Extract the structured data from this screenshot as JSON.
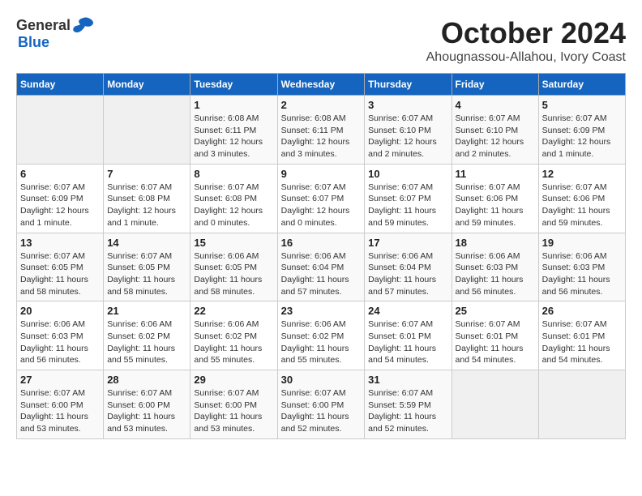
{
  "logo": {
    "general": "General",
    "blue": "Blue"
  },
  "title": "October 2024",
  "subtitle": "Ahougnassou-Allahou, Ivory Coast",
  "weekdays": [
    "Sunday",
    "Monday",
    "Tuesday",
    "Wednesday",
    "Thursday",
    "Friday",
    "Saturday"
  ],
  "weeks": [
    [
      {
        "day": "",
        "info": ""
      },
      {
        "day": "",
        "info": ""
      },
      {
        "day": "1",
        "info": "Sunrise: 6:08 AM\nSunset: 6:11 PM\nDaylight: 12 hours and 3 minutes."
      },
      {
        "day": "2",
        "info": "Sunrise: 6:08 AM\nSunset: 6:11 PM\nDaylight: 12 hours and 3 minutes."
      },
      {
        "day": "3",
        "info": "Sunrise: 6:07 AM\nSunset: 6:10 PM\nDaylight: 12 hours and 2 minutes."
      },
      {
        "day": "4",
        "info": "Sunrise: 6:07 AM\nSunset: 6:10 PM\nDaylight: 12 hours and 2 minutes."
      },
      {
        "day": "5",
        "info": "Sunrise: 6:07 AM\nSunset: 6:09 PM\nDaylight: 12 hours and 1 minute."
      }
    ],
    [
      {
        "day": "6",
        "info": "Sunrise: 6:07 AM\nSunset: 6:09 PM\nDaylight: 12 hours and 1 minute."
      },
      {
        "day": "7",
        "info": "Sunrise: 6:07 AM\nSunset: 6:08 PM\nDaylight: 12 hours and 1 minute."
      },
      {
        "day": "8",
        "info": "Sunrise: 6:07 AM\nSunset: 6:08 PM\nDaylight: 12 hours and 0 minutes."
      },
      {
        "day": "9",
        "info": "Sunrise: 6:07 AM\nSunset: 6:07 PM\nDaylight: 12 hours and 0 minutes."
      },
      {
        "day": "10",
        "info": "Sunrise: 6:07 AM\nSunset: 6:07 PM\nDaylight: 11 hours and 59 minutes."
      },
      {
        "day": "11",
        "info": "Sunrise: 6:07 AM\nSunset: 6:06 PM\nDaylight: 11 hours and 59 minutes."
      },
      {
        "day": "12",
        "info": "Sunrise: 6:07 AM\nSunset: 6:06 PM\nDaylight: 11 hours and 59 minutes."
      }
    ],
    [
      {
        "day": "13",
        "info": "Sunrise: 6:07 AM\nSunset: 6:05 PM\nDaylight: 11 hours and 58 minutes."
      },
      {
        "day": "14",
        "info": "Sunrise: 6:07 AM\nSunset: 6:05 PM\nDaylight: 11 hours and 58 minutes."
      },
      {
        "day": "15",
        "info": "Sunrise: 6:06 AM\nSunset: 6:05 PM\nDaylight: 11 hours and 58 minutes."
      },
      {
        "day": "16",
        "info": "Sunrise: 6:06 AM\nSunset: 6:04 PM\nDaylight: 11 hours and 57 minutes."
      },
      {
        "day": "17",
        "info": "Sunrise: 6:06 AM\nSunset: 6:04 PM\nDaylight: 11 hours and 57 minutes."
      },
      {
        "day": "18",
        "info": "Sunrise: 6:06 AM\nSunset: 6:03 PM\nDaylight: 11 hours and 56 minutes."
      },
      {
        "day": "19",
        "info": "Sunrise: 6:06 AM\nSunset: 6:03 PM\nDaylight: 11 hours and 56 minutes."
      }
    ],
    [
      {
        "day": "20",
        "info": "Sunrise: 6:06 AM\nSunset: 6:03 PM\nDaylight: 11 hours and 56 minutes."
      },
      {
        "day": "21",
        "info": "Sunrise: 6:06 AM\nSunset: 6:02 PM\nDaylight: 11 hours and 55 minutes."
      },
      {
        "day": "22",
        "info": "Sunrise: 6:06 AM\nSunset: 6:02 PM\nDaylight: 11 hours and 55 minutes."
      },
      {
        "day": "23",
        "info": "Sunrise: 6:06 AM\nSunset: 6:02 PM\nDaylight: 11 hours and 55 minutes."
      },
      {
        "day": "24",
        "info": "Sunrise: 6:07 AM\nSunset: 6:01 PM\nDaylight: 11 hours and 54 minutes."
      },
      {
        "day": "25",
        "info": "Sunrise: 6:07 AM\nSunset: 6:01 PM\nDaylight: 11 hours and 54 minutes."
      },
      {
        "day": "26",
        "info": "Sunrise: 6:07 AM\nSunset: 6:01 PM\nDaylight: 11 hours and 54 minutes."
      }
    ],
    [
      {
        "day": "27",
        "info": "Sunrise: 6:07 AM\nSunset: 6:00 PM\nDaylight: 11 hours and 53 minutes."
      },
      {
        "day": "28",
        "info": "Sunrise: 6:07 AM\nSunset: 6:00 PM\nDaylight: 11 hours and 53 minutes."
      },
      {
        "day": "29",
        "info": "Sunrise: 6:07 AM\nSunset: 6:00 PM\nDaylight: 11 hours and 53 minutes."
      },
      {
        "day": "30",
        "info": "Sunrise: 6:07 AM\nSunset: 6:00 PM\nDaylight: 11 hours and 52 minutes."
      },
      {
        "day": "31",
        "info": "Sunrise: 6:07 AM\nSunset: 5:59 PM\nDaylight: 11 hours and 52 minutes."
      },
      {
        "day": "",
        "info": ""
      },
      {
        "day": "",
        "info": ""
      }
    ]
  ]
}
